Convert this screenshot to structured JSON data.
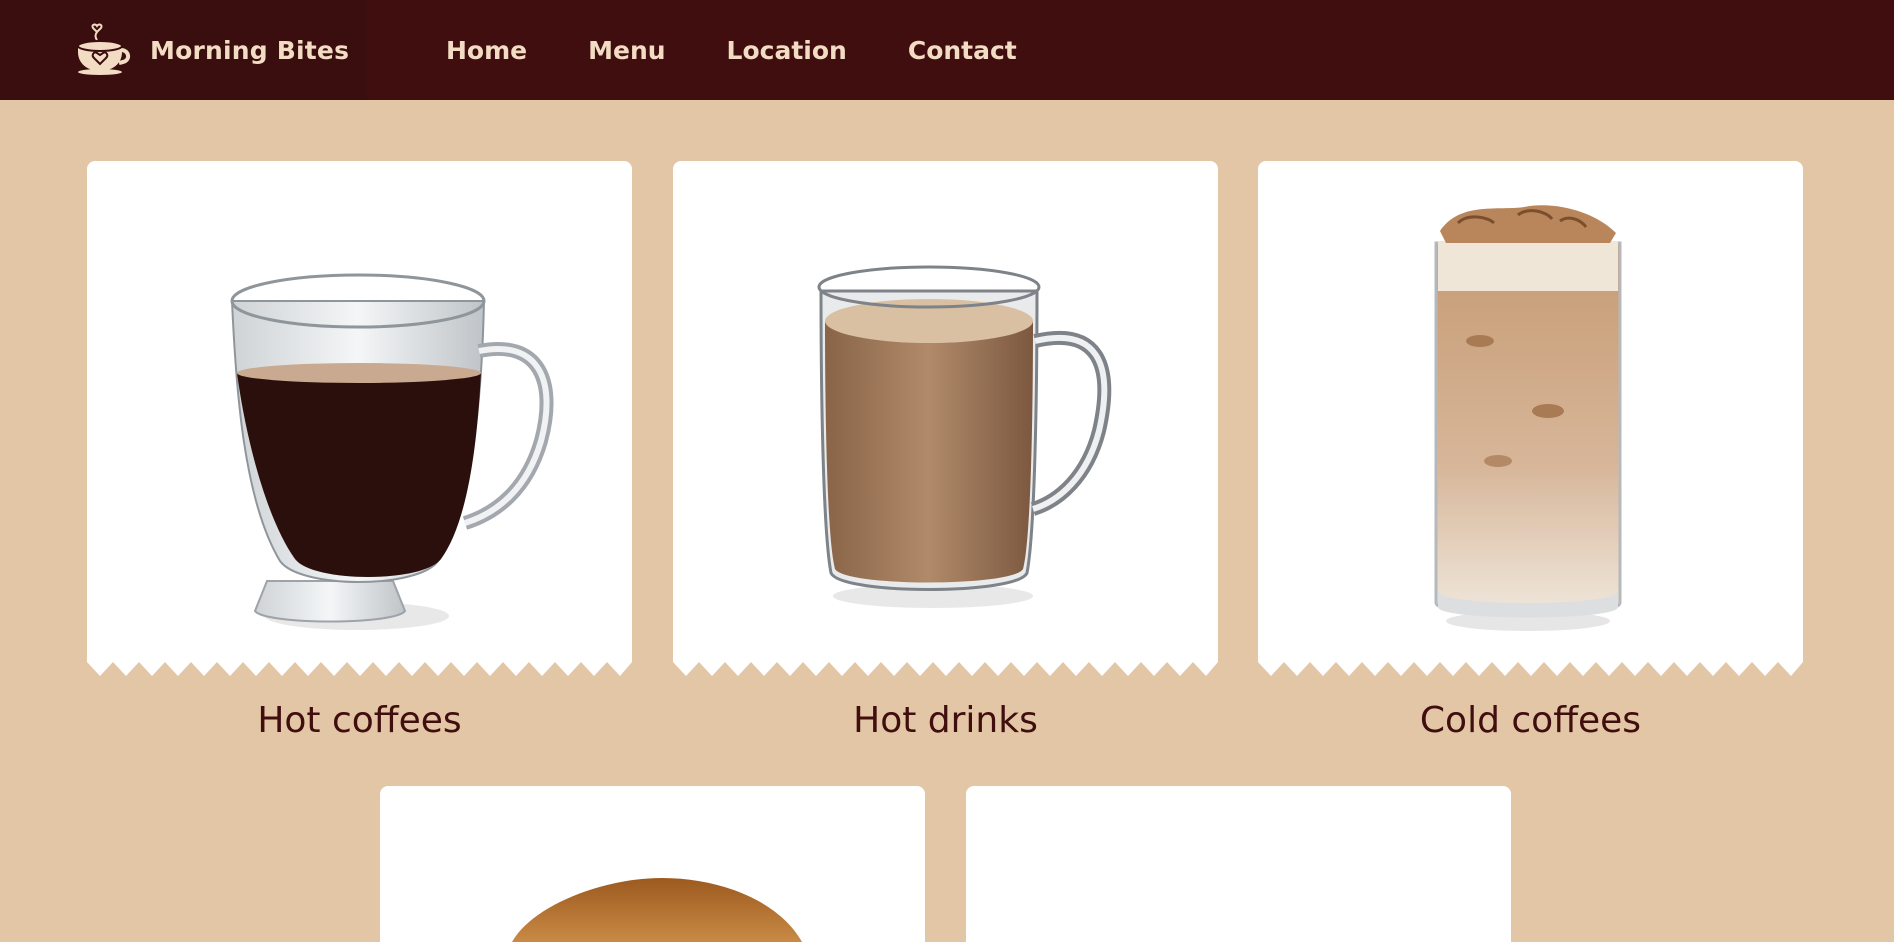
{
  "brand": {
    "name": "Morning Bites",
    "icon": "coffee-cup-heart-icon"
  },
  "nav": {
    "items": [
      {
        "label": "Home"
      },
      {
        "label": "Menu"
      },
      {
        "label": "Location"
      },
      {
        "label": "Contact"
      }
    ]
  },
  "categories": [
    {
      "label": "Hot coffees",
      "image": "black-coffee-glass-mug"
    },
    {
      "label": "Hot drinks",
      "image": "latte-glass-mug"
    },
    {
      "label": "Cold coffees",
      "image": "iced-coffee-tall-glass"
    },
    {
      "label": "",
      "image": "bagel"
    },
    {
      "label": "",
      "image": ""
    }
  ],
  "colors": {
    "nav_bg": "#410e0f",
    "brand_bg": "#3a0d0e",
    "nav_text": "#f3dcc4",
    "page_bg": "#e3c6a5",
    "card_bg": "#ffffff",
    "label_text": "#410e0f"
  }
}
